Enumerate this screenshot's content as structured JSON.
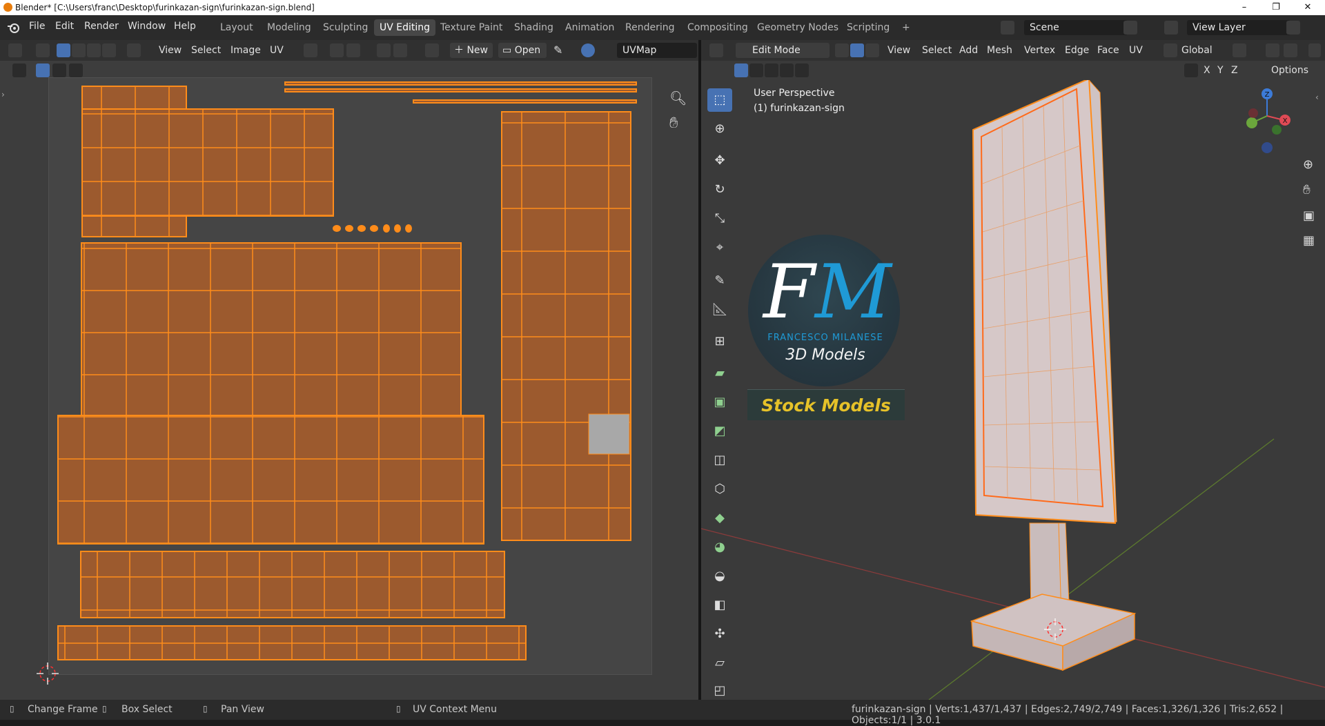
{
  "window": {
    "title": "Blender* [C:\\Users\\franc\\Desktop\\furinkazan-sign\\furinkazan-sign.blend]",
    "controls": [
      "–",
      "❐",
      "✕"
    ]
  },
  "menu": [
    "File",
    "Edit",
    "Render",
    "Window",
    "Help"
  ],
  "workspaces": [
    "Layout",
    "Modeling",
    "Sculpting",
    "UV Editing",
    "Texture Paint",
    "Shading",
    "Animation",
    "Rendering",
    "Compositing",
    "Geometry Nodes",
    "Scripting",
    "+"
  ],
  "active_workspace": "UV Editing",
  "scene": {
    "name": "Scene"
  },
  "view_layer": {
    "name": "View Layer"
  },
  "uv_header": {
    "view": "View",
    "select": "Select",
    "image": "Image",
    "uv": "UV",
    "new": "New",
    "open": "Open",
    "uvmap": "UVMap"
  },
  "v3d_header": {
    "mode": "Edit Mode",
    "view": "View",
    "select": "Select",
    "add": "Add",
    "mesh": "Mesh",
    "vertex": "Vertex",
    "edge": "Edge",
    "face": "Face",
    "uv": "UV",
    "orientation": "Global",
    "options": "Options",
    "x": "X",
    "y": "Y",
    "z": "Z"
  },
  "viewport": {
    "perspective": "User Perspective",
    "object": "(1) furinkazan-sign"
  },
  "gizmo": {
    "z": "Z",
    "x": "X"
  },
  "logo": {
    "letters_f": "F",
    "letters_m": "M",
    "name": "FRANCESCO MILANESE",
    "subtitle": "3D Models",
    "banner": "Stock Models"
  },
  "status": {
    "left1": "Change Frame",
    "left2": "Box Select",
    "left3": "Pan View",
    "left4": "UV Context Menu",
    "stats": "furinkazan-sign | Verts:1,437/1,437 | Edges:2,749/2,749 | Faces:1,326/1,326 | Tris:2,652 | Objects:1/1 | 3.0.1"
  },
  "colors": {
    "accent": "#4772b3",
    "uv_face": "#9c5a2e",
    "uv_edge": "#ff8c1a",
    "selected_tile": "#a8a8a8",
    "banner_text": "#e6c229"
  }
}
